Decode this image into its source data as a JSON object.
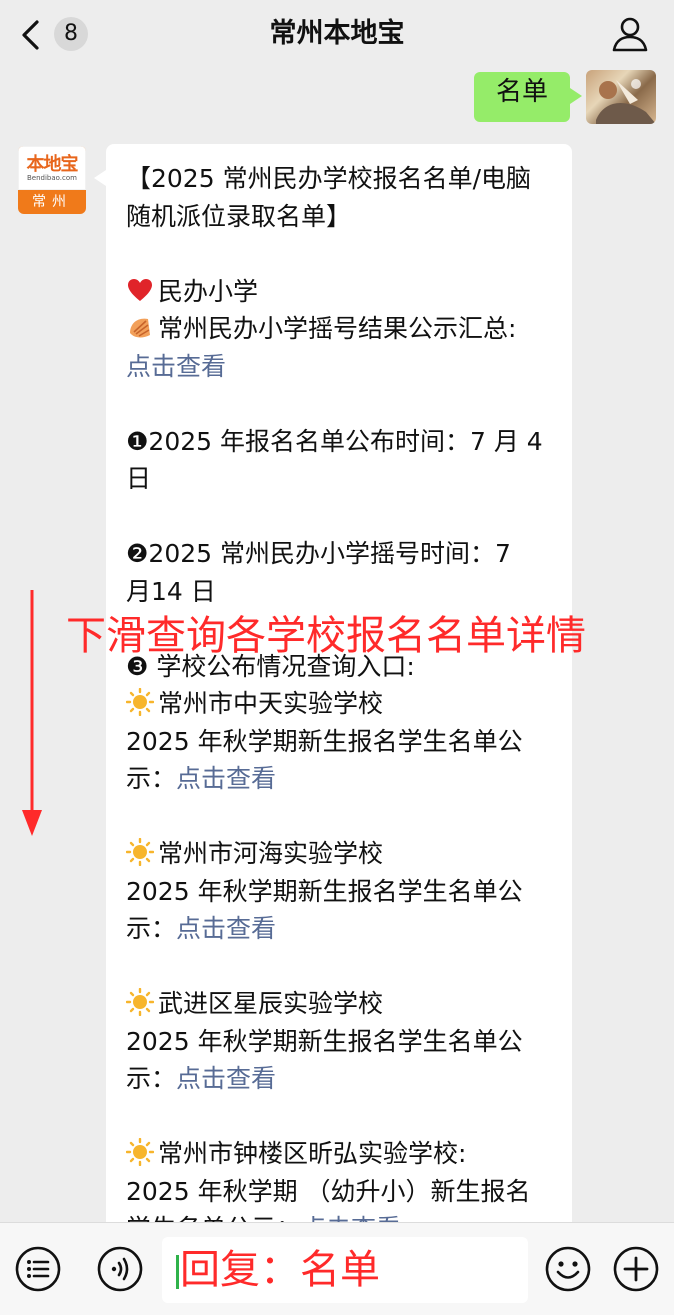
{
  "header": {
    "title": "常州本地宝",
    "unread_count": "8",
    "back_icon": "chevron-left-icon",
    "profile_icon": "person-icon"
  },
  "outgoing": {
    "text": "名单"
  },
  "account_avatar": {
    "logo": "本地宝",
    "url": "Bendibao.com",
    "city": "常州"
  },
  "message": {
    "title_line1": "【2025 常州民办学校报名名单/电脑",
    "title_line2": "随机派位录取名单】",
    "section_label": "民办小学",
    "summary_label": "常州民办小学摇号结果公示汇总:",
    "summary_link": "点击查看",
    "item1_line1": "❶2025 年报名名单公布时间：7 月 4",
    "item1_line2": "日",
    "item2_line1": "❷2025 常州民办小学摇号时间：7",
    "item2_line2": "月14 日",
    "item3_label": "❸ 学校公布情况查询入口:",
    "schools": [
      {
        "name": "常州市中天实验学校",
        "desc_line1": "2025 年秋学期新生报名学生名单公",
        "desc_line2": "示：",
        "link": "点击查看"
      },
      {
        "name": "常州市河海实验学校",
        "desc_line1": "2025 年秋学期新生报名学生名单公",
        "desc_line2": "示：",
        "link": "点击查看"
      },
      {
        "name": "武进区星辰实验学校",
        "desc_line1": "2025 年秋学期新生报名学生名单公",
        "desc_line2": "示：",
        "link": "点击查看"
      },
      {
        "name": "常州市钟楼区昕弘实验学校:",
        "desc_line1": "2025 年秋学期 （幼升小）新生报名",
        "desc_line2": "学生名单公示：",
        "link": "点击查看"
      }
    ]
  },
  "overlay": {
    "text": "下滑查询各学校报名名单详情",
    "color": "#ff2a2a"
  },
  "input": {
    "text": "回复：名单",
    "voice_icon": "voice-icon",
    "menu_icon": "list-icon",
    "emoji_icon": "smile-icon",
    "plus_icon": "plus-icon"
  },
  "colors": {
    "background": "#ededed",
    "bubble_out": "#95ec69",
    "link": "#576b95",
    "accent": "#f07a1a"
  }
}
